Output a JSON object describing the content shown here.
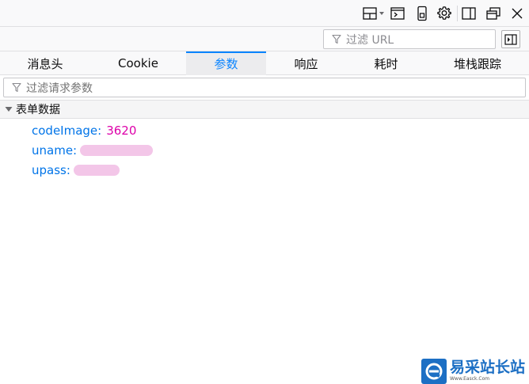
{
  "toolbar": {
    "icons": [
      "layout-toggle-icon",
      "console-split-icon",
      "responsive-mode-icon",
      "settings-icon",
      "dock-side-icon",
      "undock-window-icon",
      "close-icon"
    ]
  },
  "url_filter": {
    "placeholder": "过滤 URL"
  },
  "tabs": [
    {
      "label": "消息头",
      "active": false
    },
    {
      "label": "Cookie",
      "active": false
    },
    {
      "label": "参数",
      "active": true
    },
    {
      "label": "响应",
      "active": false
    },
    {
      "label": "耗时",
      "active": false
    },
    {
      "label": "堆栈跟踪",
      "active": false
    }
  ],
  "param_filter": {
    "placeholder": "过滤请求参数"
  },
  "form_section": {
    "title": "表单数据",
    "params": [
      {
        "key": "codeImage:",
        "value": "3620"
      },
      {
        "key": "uname:",
        "value": ""
      },
      {
        "key": "upass:",
        "value": ""
      }
    ]
  },
  "watermark": {
    "name": "易采站长站",
    "sub": "Www.Easck.Com"
  },
  "colors": {
    "accent": "#0a84ff",
    "key": "#0074e8",
    "value": "#dd00a9",
    "watermark": "#1c6fc4"
  }
}
